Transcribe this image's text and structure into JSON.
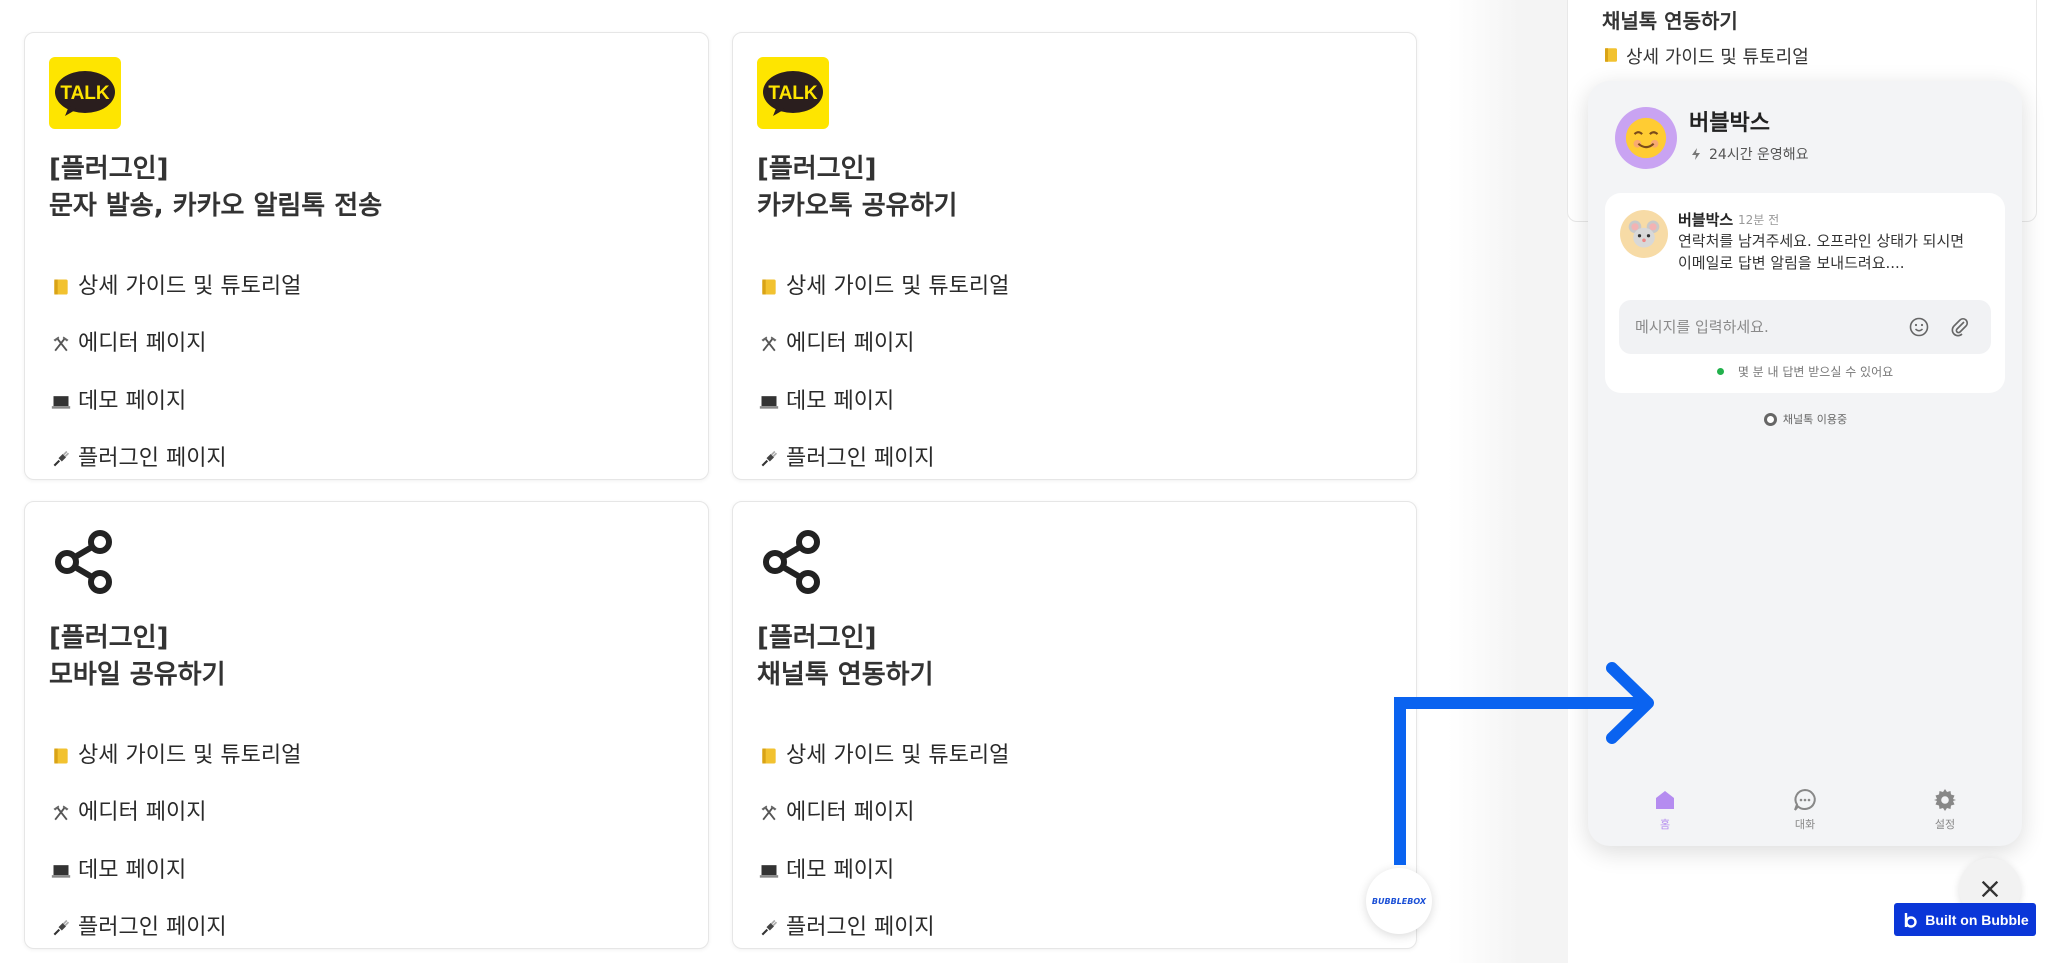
{
  "cards": [
    {
      "logo": "kakaotalk-logo",
      "kicker": "[플러그인]",
      "title": "문자 발송, 카카오 알림톡 전송",
      "links": [
        "상세 가이드 및 튜토리얼",
        "에디터 페이지",
        "데모 페이지",
        "플러그인 페이지"
      ]
    },
    {
      "logo": "kakaotalk-logo",
      "kicker": "[플러그인]",
      "title": "카카오톡 공유하기",
      "links": [
        "상세 가이드 및 튜토리얼",
        "에디터 페이지",
        "데모 페이지",
        "플러그인 페이지"
      ]
    },
    {
      "logo": "share-icon",
      "kicker": "[플러그인]",
      "title": "모바일 공유하기",
      "links": [
        "상세 가이드 및 튜토리얼",
        "에디터 페이지",
        "데모 페이지",
        "플러그인 페이지"
      ]
    },
    {
      "logo": "share-icon",
      "kicker": "[플러그인]",
      "title": "채널톡 연동하기",
      "links": [
        "상세 가이드 및 튜토리얼",
        "에디터 페이지",
        "데모 페이지",
        "플러그인 페이지"
      ]
    }
  ],
  "link_icons": [
    "ledger-icon",
    "hammer-pick-icon",
    "laptop-icon",
    "plug-icon"
  ],
  "logo_text": "TALK",
  "background_panel": {
    "title": "채널톡 연동하기",
    "link": "상세 가이드 및 튜토리얼"
  },
  "chat_widget": {
    "name": "버블박스",
    "hours": "24시간 운영해요",
    "message": {
      "sender": "버블박스",
      "time": "12분 전",
      "text": "연락처를 남겨주세요. 오프라인 상태가 되시면 이메일로 답변 알림을 보내드려요...."
    },
    "input_placeholder": "메시지를 입력하세요.",
    "reply_note": "몇 분 내 답변 받으실 수 있어요",
    "powered_by": "채널톡 이용중",
    "nav": [
      {
        "label": "홈",
        "icon": "home-icon",
        "active": true
      },
      {
        "label": "대화",
        "icon": "chat-icon",
        "active": false
      },
      {
        "label": "설정",
        "icon": "gear-icon",
        "active": false
      }
    ]
  },
  "launcher_label": "BUBBLEBOX",
  "built_on_label": "Built on Bubble",
  "colors": {
    "kakao_yellow": "#FEE500",
    "accent_purple": "#b58cf0",
    "arrow_blue": "#0a63f0",
    "bubble_blue": "#0a36d8",
    "online_green": "#22b14c"
  }
}
